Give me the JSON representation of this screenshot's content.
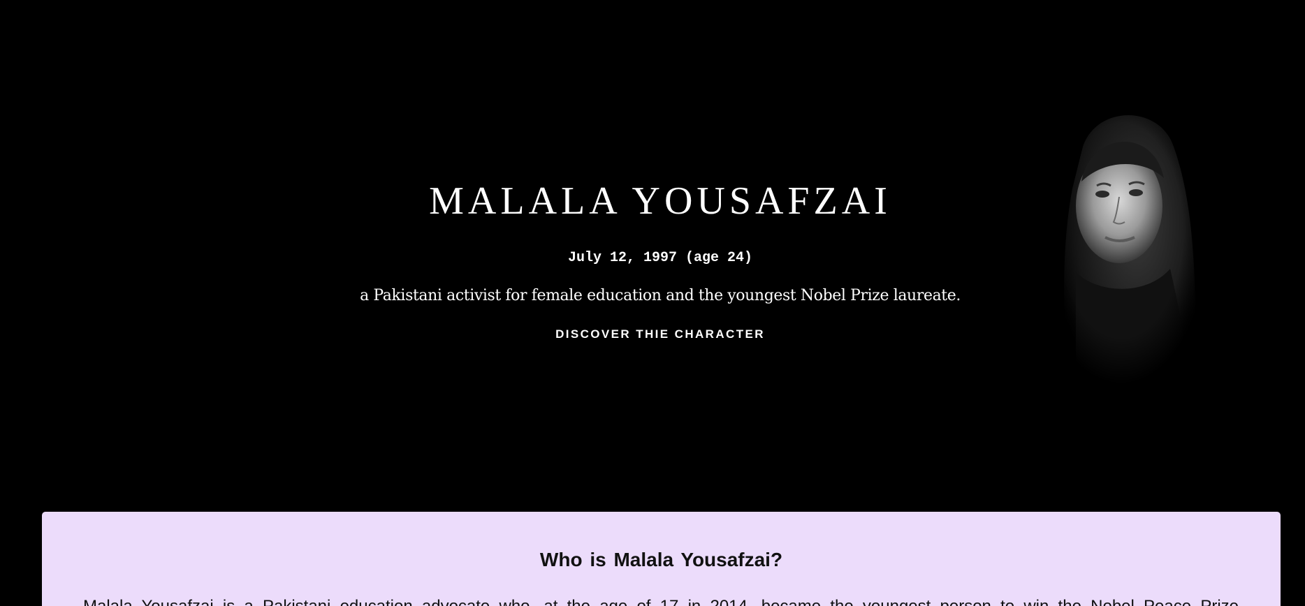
{
  "hero": {
    "title": "MALALA YOUSAFZAI",
    "date": "July 12, 1997 (age 24)",
    "tagline": "a Pakistani activist for female education and the youngest Nobel Prize laureate.",
    "cta_label": "DISCOVER THIE CHARACTER",
    "portrait_icon": "portrait-photo"
  },
  "about": {
    "heading": "Who is Malala Yousafzai?",
    "body": "Malala Yousafzai is a Pakistani education advocate who, at the age of 17 in 2014, became the youngest person to win the Nobel Peace Prize"
  },
  "colors": {
    "background": "#000000",
    "card_background": "#ecdcfb",
    "hero_text": "#ffffff",
    "card_text": "#111111"
  }
}
